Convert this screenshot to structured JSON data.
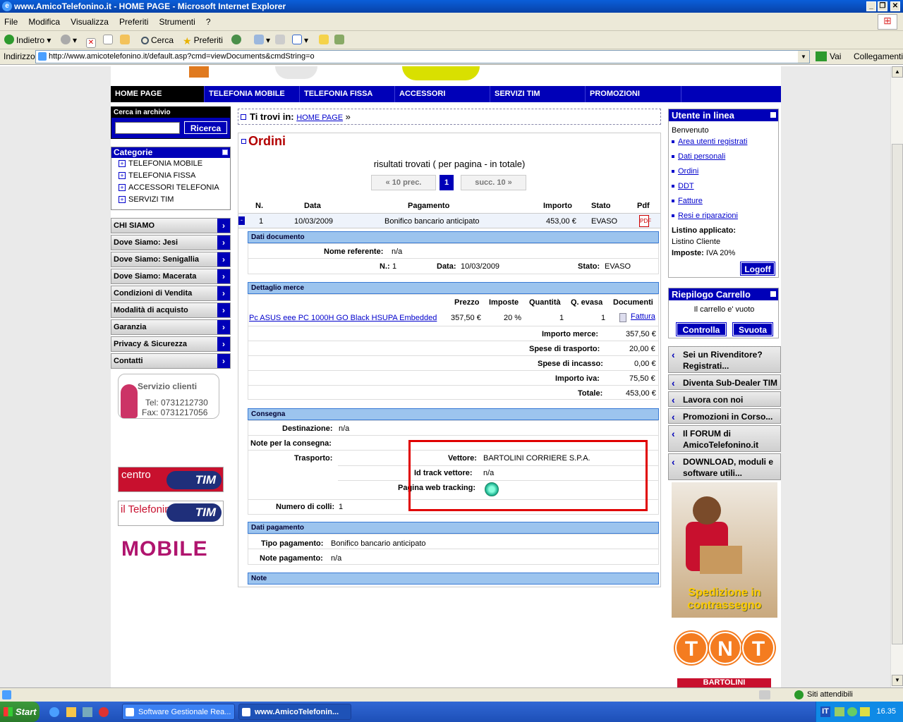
{
  "window": {
    "title": "www.AmicoTelefonino.it - HOME PAGE - Microsoft Internet Explorer",
    "minimize": "_",
    "restore": "❐",
    "close": "✕"
  },
  "menubar": [
    "File",
    "Modifica",
    "Visualizza",
    "Preferiti",
    "Strumenti",
    "?"
  ],
  "toolbar": {
    "back": "Indietro",
    "search": "Cerca",
    "favorites": "Preferiti"
  },
  "address": {
    "label": "Indirizzo",
    "url": "http://www.amicotelefonino.it/default.asp?cmd=viewDocuments&cmdString=o",
    "go": "Vai",
    "links": "Collegamenti"
  },
  "topnav": [
    "HOME PAGE",
    "TELEFONIA MOBILE",
    "TELEFONIA FISSA",
    "ACCESSORI",
    "SERVIZI TIM",
    "PROMOZIONI"
  ],
  "search": {
    "title": "Cerca in archivio",
    "button": "Ricerca"
  },
  "categories": {
    "title": "Categorie",
    "items": [
      "TELEFONIA MOBILE",
      "TELEFONIA FISSA",
      "ACCESSORI TELEFONIA",
      "SERVIZI TIM"
    ]
  },
  "leftmenu": [
    "CHI SIAMO",
    "Dove Siamo: Jesi",
    "Dove Siamo: Senigallia",
    "Dove Siamo: Macerata",
    "Condizioni di Vendita",
    "Modalità di acquisto",
    "Garanzia",
    "Privacy & Sicurezza",
    "Contatti"
  ],
  "servizio": {
    "title": "Servizio clienti",
    "tel": "Tel: 0731212730",
    "fax": "Fax: 0731217056"
  },
  "banners": {
    "centro": "centro",
    "telefonino": "il Telefonino",
    "tim": "TIM",
    "mobile": "MOBILE"
  },
  "breadcrumb": {
    "label": "Ti trovi in:",
    "link": "HOME PAGE",
    "sep": "»"
  },
  "orders": {
    "title": "Ordini",
    "results": "risultati trovati ( per pagina - in totale)",
    "prev": "« 10 prec.",
    "page": "1",
    "next": "succ. 10 »",
    "headers": [
      "N.",
      "Data",
      "Pagamento",
      "Importo",
      "Stato",
      "Pdf"
    ],
    "row": {
      "toggle": "-",
      "n": "1",
      "data": "10/03/2009",
      "pagamento": "Bonifico bancario anticipato",
      "importo": "453,00 €",
      "stato": "EVASO"
    }
  },
  "doc": {
    "title": "Dati documento",
    "ref_label": "Nome referente:",
    "ref": "n/a",
    "n_label": "N.:",
    "n": "1",
    "data_label": "Data:",
    "data": "10/03/2009",
    "stato_label": "Stato:",
    "stato": "EVASO"
  },
  "merce": {
    "title": "Dettaglio merce",
    "headers": [
      "Prezzo",
      "Imposte",
      "Quantità",
      "Q. evasa",
      "Documenti"
    ],
    "item": {
      "name": "Pc ASUS eee PC 1000H GO Black HSUPA Embedded",
      "prezzo": "357,50 €",
      "imposte": "20 %",
      "qta": "1",
      "evasa": "1",
      "doc": "Fattura"
    },
    "totals": [
      {
        "label": "Importo merce:",
        "value": "357,50 €"
      },
      {
        "label": "Spese di trasporto:",
        "value": "20,00 €"
      },
      {
        "label": "Spese di incasso:",
        "value": "0,00 €"
      },
      {
        "label": "Importo iva:",
        "value": "75,50 €"
      },
      {
        "label": "Totale:",
        "value": "453,00 €"
      }
    ]
  },
  "consegna": {
    "title": "Consegna",
    "dest_label": "Destinazione:",
    "dest": "n/a",
    "note_label": "Note per la consegna:",
    "trasporto_label": "Trasporto:",
    "vettore_label": "Vettore:",
    "vettore": "BARTOLINI CORRIERE S.P.A.",
    "track_label": "Id track vettore:",
    "track": "n/a",
    "web_label": "Pagina web tracking:",
    "colli_label": "Numero di colli:",
    "colli": "1"
  },
  "pagamento": {
    "title": "Dati pagamento",
    "tipo_label": "Tipo pagamento:",
    "tipo": "Bonifico bancario anticipato",
    "note_label": "Note pagamento:",
    "note": "n/a"
  },
  "note": {
    "title": "Note"
  },
  "user": {
    "title": "Utente in linea",
    "welcome": "Benvenuto",
    "links": [
      "Area utenti registrati",
      "Dati personali",
      "Ordini",
      "DDT",
      "Fatture",
      "Resi e riparazioni"
    ],
    "listino_label": "Listino applicato:",
    "listino": "Listino Cliente",
    "imposte_label": "Imposte:",
    "imposte": "IVA 20%",
    "logoff": "Logoff"
  },
  "cart": {
    "title": "Riepilogo Carrello",
    "empty": "Il carrello e' vuoto",
    "check": "Controlla",
    "empty_btn": "Svuota"
  },
  "rightmenu": [
    {
      "l1": "Sei un Rivenditore?",
      "l2": "Registrati..."
    },
    {
      "l1": "Diventa Sub-Dealer TIM",
      "l2": ""
    },
    {
      "l1": "Lavora con noi",
      "l2": ""
    },
    {
      "l1": "Promozioni in Corso...",
      "l2": ""
    },
    {
      "l1": "Il FORUM di",
      "l2": "AmicoTelefonino.it"
    },
    {
      "l1": "DOWNLOAD, moduli e",
      "l2": "software utili..."
    }
  ],
  "courier": {
    "l1": "Spedizione in",
    "l2": "contrassegno"
  },
  "tnt": [
    "T",
    "N",
    "T"
  ],
  "bartolini": "BARTOLINI",
  "status": {
    "zone": "Siti attendibili"
  },
  "taskbar": {
    "start": "Start",
    "tasks": [
      "Software Gestionale Rea...",
      "www.AmicoTelefonin..."
    ],
    "lang": "IT",
    "clock": "16.35"
  }
}
